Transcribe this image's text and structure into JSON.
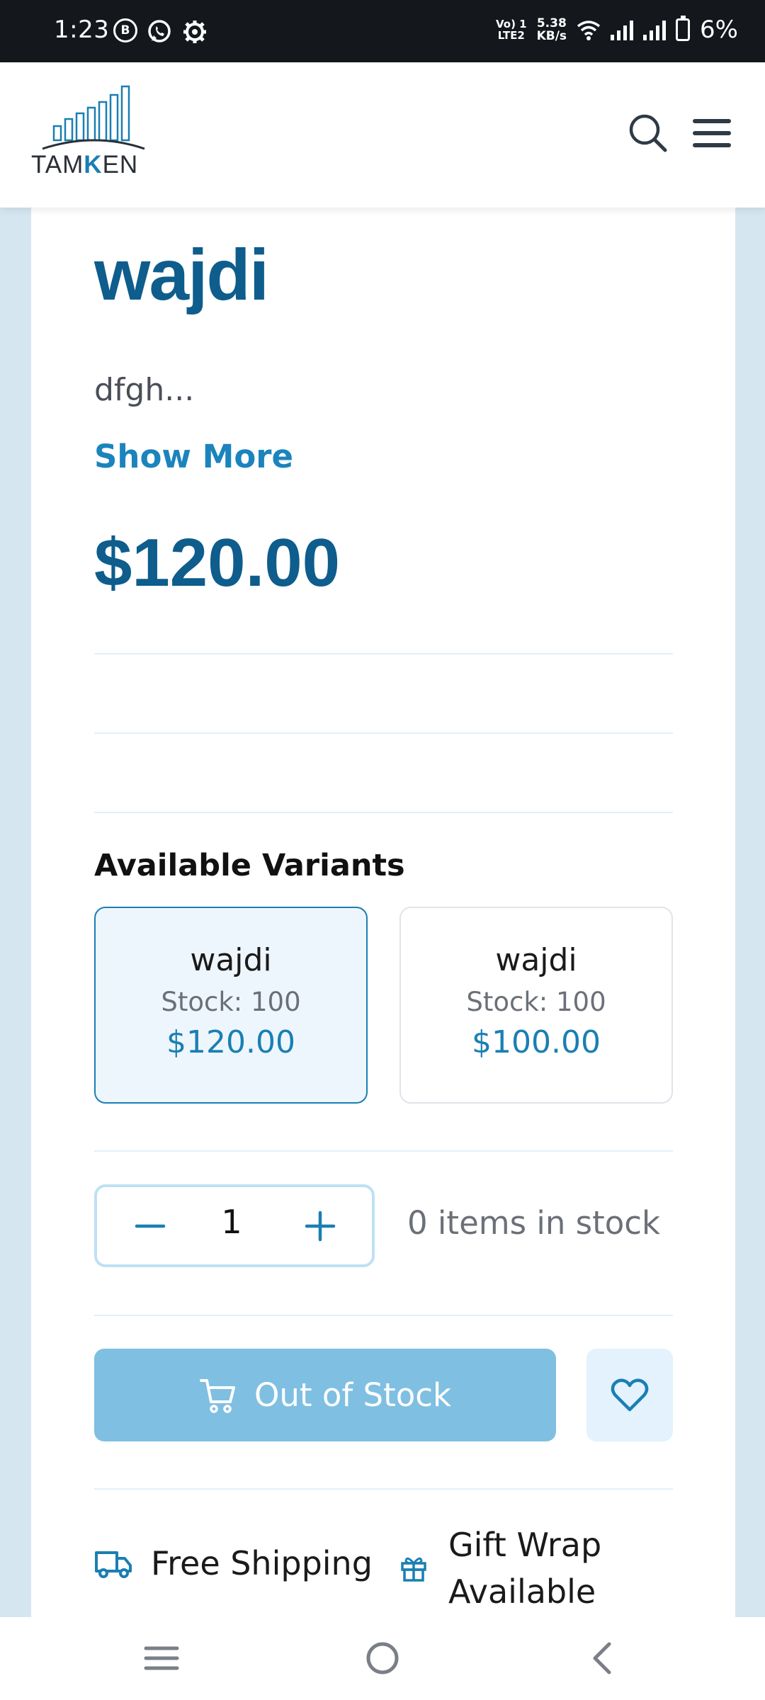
{
  "status_bar": {
    "time": "1:23",
    "notif_icons": [
      "b-icon",
      "whatsapp-icon",
      "settings-icon"
    ],
    "volte_line1": "Vo) 1",
    "volte_line2": "LTE2",
    "speed_value": "5.38",
    "speed_unit": "KB/s",
    "battery": "6%"
  },
  "header": {
    "logo_text_a": "TAM",
    "logo_text_k": "K",
    "logo_text_b": "EN",
    "brand_color": "#1a7fb3"
  },
  "product": {
    "title": "wajdi",
    "description": "dfgh...",
    "show_more": "Show More",
    "price": "$120.00"
  },
  "variants": {
    "heading": "Available Variants",
    "items": [
      {
        "name": "wajdi",
        "stock": "Stock: 100",
        "price": "$120.00",
        "selected": true
      },
      {
        "name": "wajdi",
        "stock": "Stock: 100",
        "price": "$100.00",
        "selected": false
      }
    ]
  },
  "quantity": {
    "value": "1",
    "stock_text": "0 items in stock"
  },
  "actions": {
    "out_of_stock": "Out of Stock"
  },
  "features": {
    "shipping": "Free Shipping",
    "gift_line1": "Gift Wrap",
    "gift_line2": "Available"
  },
  "colors": {
    "primary_dark": "#0e5d8c",
    "accent": "#1b84bd",
    "disabled_button": "#7fbfe2"
  }
}
